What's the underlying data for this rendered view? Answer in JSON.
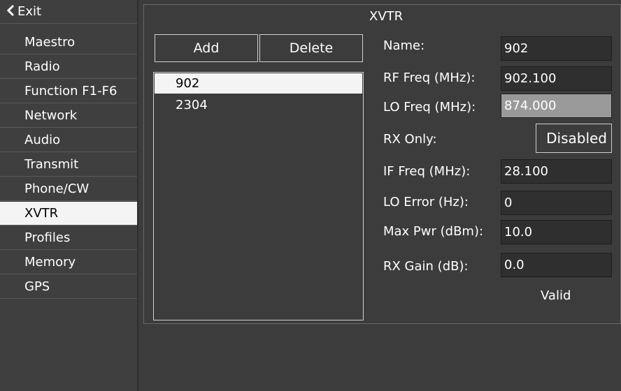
{
  "sidebar": {
    "exit_label": "Exit",
    "items": [
      {
        "label": "Maestro",
        "selected": false
      },
      {
        "label": "Radio",
        "selected": false
      },
      {
        "label": "Function F1-F6",
        "selected": false
      },
      {
        "label": "Network",
        "selected": false
      },
      {
        "label": "Audio",
        "selected": false
      },
      {
        "label": "Transmit",
        "selected": false
      },
      {
        "label": "Phone/CW",
        "selected": false
      },
      {
        "label": "XVTR",
        "selected": true
      },
      {
        "label": "Profiles",
        "selected": false
      },
      {
        "label": "Memory",
        "selected": false
      },
      {
        "label": "GPS",
        "selected": false
      }
    ]
  },
  "panel": {
    "title": "XVTR",
    "add_label": "Add",
    "delete_label": "Delete",
    "list": [
      {
        "label": "902",
        "selected": true
      },
      {
        "label": "2304",
        "selected": false
      }
    ],
    "fields": {
      "name": {
        "label": "Name:",
        "value": "902"
      },
      "rf_freq": {
        "label": "RF Freq (MHz):",
        "value": "902.100"
      },
      "lo_freq": {
        "label": "LO Freq (MHz):",
        "value": "874.000"
      },
      "rx_only": {
        "label": "RX Only:",
        "value": "Disabled"
      },
      "if_freq": {
        "label": "IF Freq (MHz):",
        "value": "28.100"
      },
      "lo_error": {
        "label": "LO Error (Hz):",
        "value": "0"
      },
      "max_pwr": {
        "label": "Max Pwr (dBm):",
        "value": "10.0"
      },
      "rx_gain": {
        "label": "RX Gain (dB):",
        "value": "0.0"
      }
    },
    "status": "Valid"
  },
  "colors": {
    "background": "#3c3c3c",
    "selected_bg": "#f4f4f4",
    "field_bg": "#2f2f2f",
    "lo_field_bg": "#9a9a9a"
  }
}
